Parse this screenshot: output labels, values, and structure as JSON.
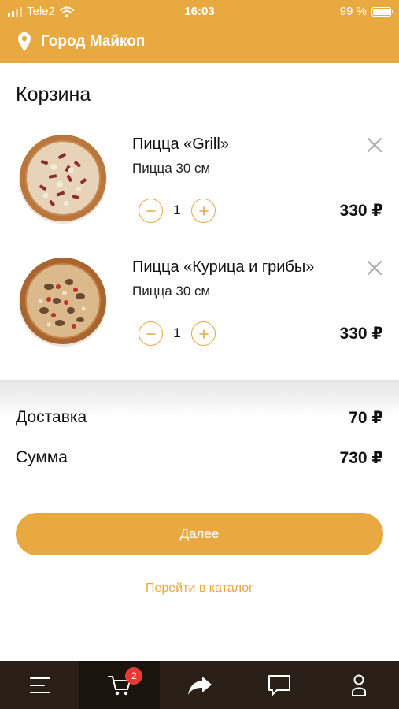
{
  "status_bar": {
    "carrier": "Tele2",
    "time": "16:03",
    "battery": "99 %",
    "battery_level": 0.99
  },
  "header": {
    "city": "Город Майкоп",
    "location_icon": "location-pin-icon"
  },
  "cart": {
    "title": "Корзина",
    "items": [
      {
        "name": "Пицца «Grill»",
        "size": "Пицца 30 см",
        "quantity": "1",
        "price": "330 ₽"
      },
      {
        "name": "Пицца «Курица и грибы»",
        "size": "Пицца 30 см",
        "quantity": "1",
        "price": "330 ₽"
      }
    ]
  },
  "summary": {
    "delivery_label": "Доставка",
    "delivery_value": "70 ₽",
    "total_label": "Сумма",
    "total_value": "730 ₽"
  },
  "actions": {
    "next_label": "Далее",
    "catalog_link": "Перейти в каталог"
  },
  "tabbar": {
    "cart_badge": "2",
    "tabs": [
      "menu-icon",
      "cart-icon",
      "share-icon",
      "chat-icon",
      "profile-icon"
    ]
  },
  "colors": {
    "accent": "#e8a940",
    "tabbar": "#2a2017",
    "badge": "#e53935"
  }
}
